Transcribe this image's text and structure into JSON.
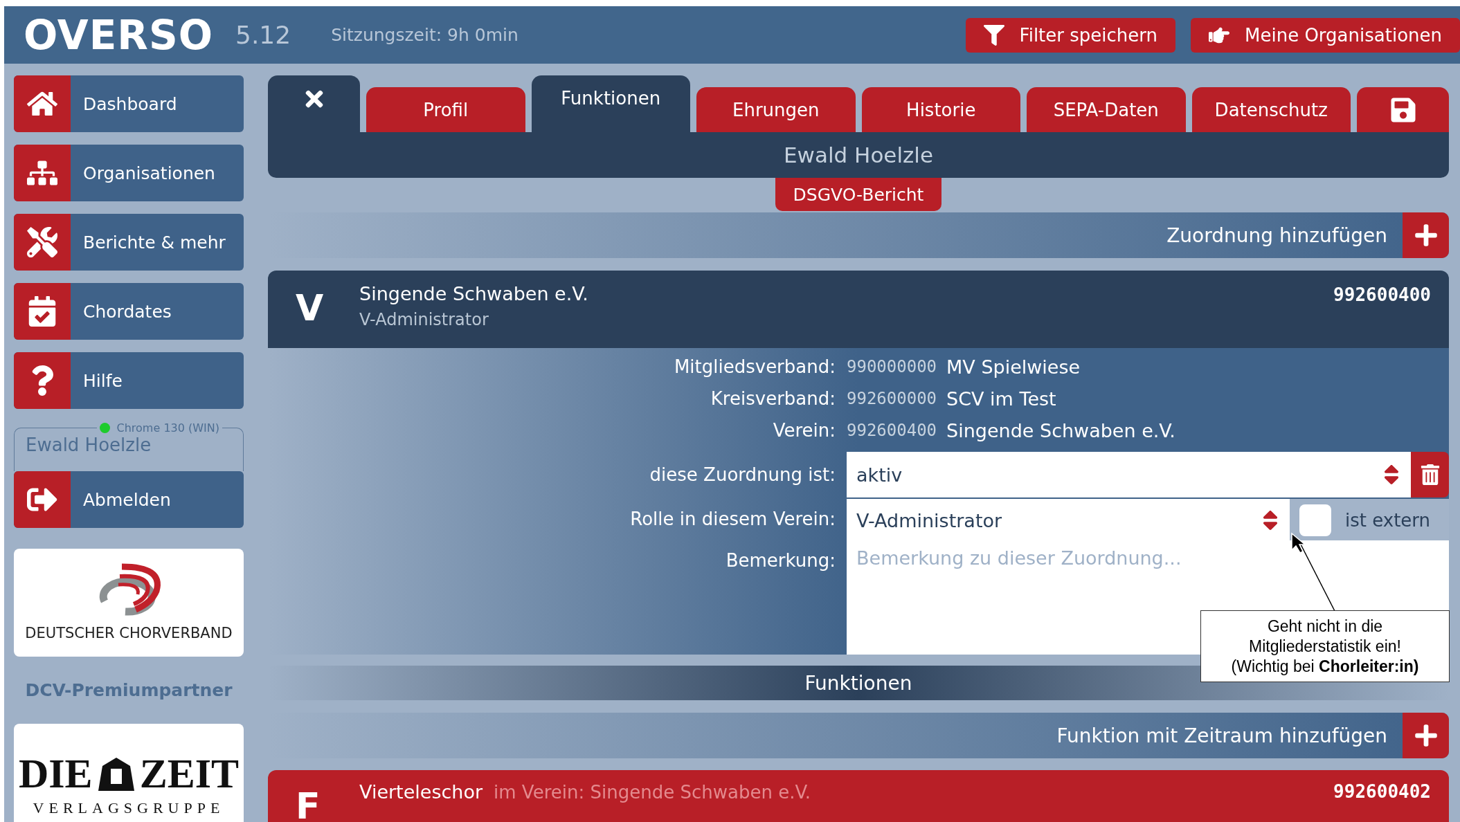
{
  "header": {
    "logo": "OVERSO",
    "version": "5.12",
    "session": "Sitzungszeit: 9h 0min",
    "buttons": [
      {
        "label": "Filter speichern"
      },
      {
        "label": "Meine Organisationen"
      }
    ]
  },
  "sidebar": {
    "items": [
      {
        "label": "Dashboard"
      },
      {
        "label": "Organisationen"
      },
      {
        "label": "Berichte & mehr"
      },
      {
        "label": "Chordates"
      },
      {
        "label": "Hilfe"
      }
    ],
    "user": {
      "browser": "Chrome 130 (WIN)",
      "online": true,
      "name": "Ewald Hoelzle"
    },
    "logout": "Abmelden",
    "partner_logo": {
      "name": "DEUTSCHER CHORVERBAND"
    },
    "partner_label": "DCV-Premiumpartner",
    "sponsor_logo": {
      "title_left": "DIE",
      "title_right": "ZEIT",
      "subtitle": "VERLAGSGRUPPE"
    }
  },
  "tabs": [
    {
      "label": "Profil",
      "selected": false
    },
    {
      "label": "Funktionen",
      "selected": true
    },
    {
      "label": "Ehrungen",
      "selected": false
    },
    {
      "label": "Historie",
      "selected": false
    },
    {
      "label": "SEPA-Daten",
      "selected": false
    },
    {
      "label": "Datenschutz",
      "selected": false
    }
  ],
  "person": "Ewald Hoelzle",
  "report_button": "DSGVO-Bericht",
  "add_assignment": "Zuordnung hinzufügen",
  "assignment": {
    "letter": "V",
    "name": "Singende Schwaben e.V.",
    "role": "V-Administrator",
    "number": "992600400",
    "details": [
      {
        "label": "Mitgliedsverband:",
        "code": "990000000",
        "name": "MV Spielwiese"
      },
      {
        "label": "Kreisverband:",
        "code": "992600000",
        "name": "SCV im Test"
      },
      {
        "label": "Verein:",
        "code": "992600400",
        "name": "Singende Schwaben e.V."
      }
    ],
    "status": {
      "label": "diese Zuordnung ist:",
      "value": "aktiv"
    },
    "role_field": {
      "label": "Rolle in diesem Verein:",
      "value": "V-Administrator"
    },
    "external": {
      "label": "ist extern",
      "checked": false
    },
    "remark": {
      "label": "Bemerkung:",
      "placeholder": "Bemerkung zu dieser Zuordnung..."
    }
  },
  "functions_heading": "Funktionen",
  "add_function": "Funktion mit Zeitraum hinzufügen",
  "function_card": {
    "letter": "F",
    "name": "Vierteleschor",
    "context": "im Verein: Singende Schwaben e.V.",
    "number": "992600402"
  },
  "callout": {
    "text": "Geht nicht in die Mitgliederstatistik ein! (Wichtig bei **Chorleiter:in)**"
  }
}
